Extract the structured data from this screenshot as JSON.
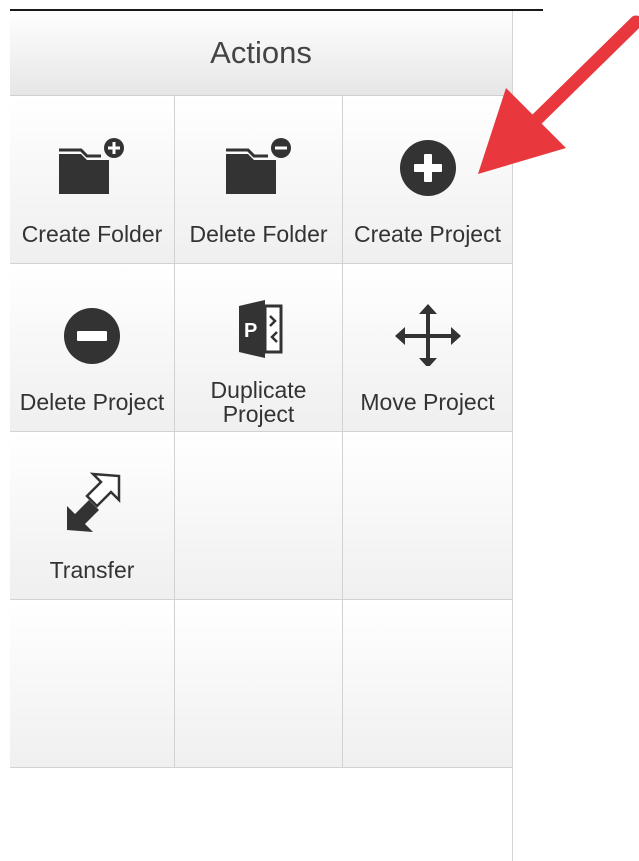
{
  "panel": {
    "title": "Actions"
  },
  "actions": [
    {
      "label": "Create Folder",
      "icon": "folder-add-icon"
    },
    {
      "label": "Delete Folder",
      "icon": "folder-remove-icon"
    },
    {
      "label": "Create Project",
      "icon": "plus-circle-icon"
    },
    {
      "label": "Delete Project",
      "icon": "minus-circle-icon"
    },
    {
      "label": "Duplicate Project",
      "icon": "project-duplicate-icon"
    },
    {
      "label": "Move Project",
      "icon": "move-arrows-icon"
    },
    {
      "label": "Transfer",
      "icon": "transfer-arrows-icon"
    }
  ],
  "colors": {
    "icon": "#333333",
    "annotation_arrow": "#e8383d"
  }
}
